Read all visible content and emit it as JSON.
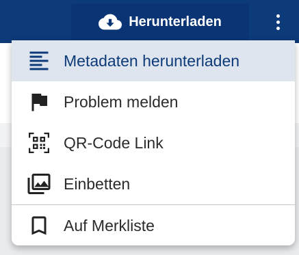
{
  "header": {
    "download_label": "Herunterladen",
    "download_icon": "cloud-download-icon",
    "more_icon": "kebab-menu-icon"
  },
  "menu": {
    "items": [
      {
        "label": "Metadaten herunterladen",
        "icon": "metadata-lines-icon",
        "active": true
      },
      {
        "label": "Problem melden",
        "icon": "flag-icon"
      },
      {
        "label": "QR-Code Link",
        "icon": "qr-code-icon"
      },
      {
        "label": "Einbetten",
        "icon": "embed-images-icon"
      },
      {
        "label": "Auf Merkliste",
        "icon": "bookmark-icon"
      }
    ]
  },
  "colors": {
    "header_bg": "#0d3a78",
    "active_item_bg": "#dfe5ee",
    "active_item_text": "#0d3a78"
  }
}
